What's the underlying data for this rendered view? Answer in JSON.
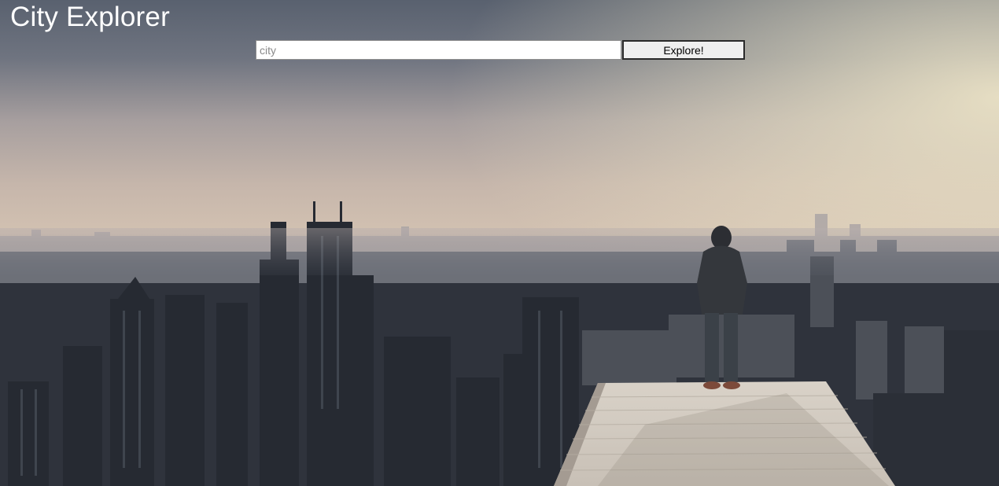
{
  "app": {
    "title": "City Explorer"
  },
  "search": {
    "placeholder": "city",
    "value": "",
    "button_label": "Explore!"
  },
  "background": {
    "subject": "city skyline with person standing on rooftop ledge"
  },
  "colors": {
    "title_text": "#ffffff",
    "button_bg": "#efefef",
    "input_bg": "#ffffff"
  }
}
